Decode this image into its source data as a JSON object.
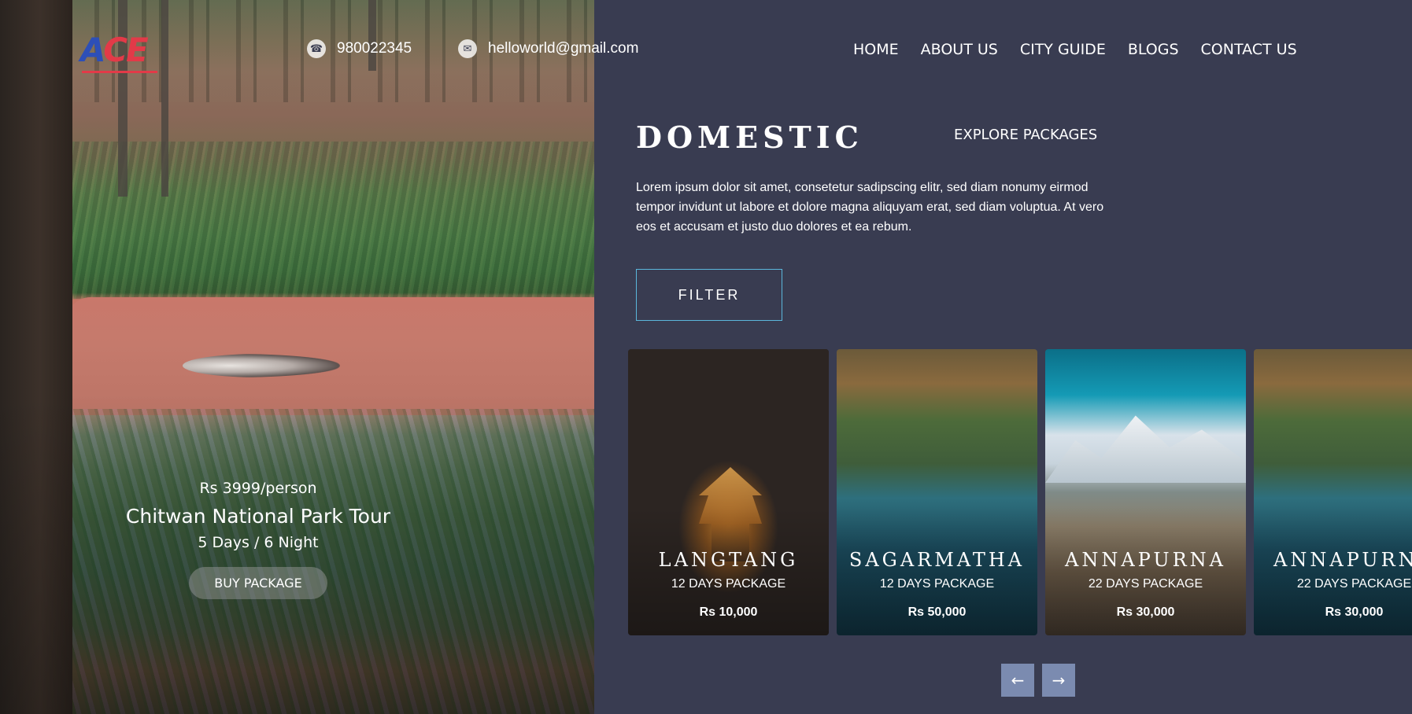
{
  "brand": {
    "logo_text": "ACE",
    "accent": "#e23a48",
    "secondary": "#2d4fb8"
  },
  "contact": {
    "phone_icon": "phone-icon",
    "phone": "980022345",
    "email_icon": "envelope-icon",
    "email": "helloworld@gmail.com"
  },
  "nav": {
    "items": [
      "HOME",
      "ABOUT US",
      "CITY GUIDE",
      "BLOGS",
      "CONTACT US"
    ]
  },
  "hero": {
    "price": "Rs 3999/person",
    "title": "Chitwan National Park Tour",
    "duration": "5 Days / 6 Night",
    "cta": "BUY PACKAGE"
  },
  "section": {
    "heading": "DOMESTIC",
    "explore_link": "EXPLORE PACKAGES",
    "description": "Lorem ipsum dolor sit amet, consetetur sadipscing elitr, sed diam nonumy eirmod tempor invidunt ut labore et dolore magna aliquyam erat, sed diam voluptua. At vero eos et accusam et justo duo dolores et ea rebum.",
    "filter_label": "FILTER"
  },
  "cards": [
    {
      "name": "LANGTANG",
      "package": "12 DAYS PACKAGE",
      "price": "Rs 10,000"
    },
    {
      "name": "SAGARMATHA",
      "package": "12 DAYS PACKAGE",
      "price": "Rs 50,000"
    },
    {
      "name": "ANNAPURNA",
      "package": "22 DAYS PACKAGE",
      "price": "Rs 30,000"
    },
    {
      "name": "ANNAPURNA",
      "package": "22 DAYS PACKAGE",
      "price": "Rs 30,000"
    }
  ],
  "carousel": {
    "prev_icon": "arrow-left-icon",
    "next_icon": "arrow-right-icon"
  },
  "colors": {
    "panel_bg": "#393c51",
    "filter_border": "#5bb7dc",
    "arrow_bg": "#7b8bb0"
  }
}
